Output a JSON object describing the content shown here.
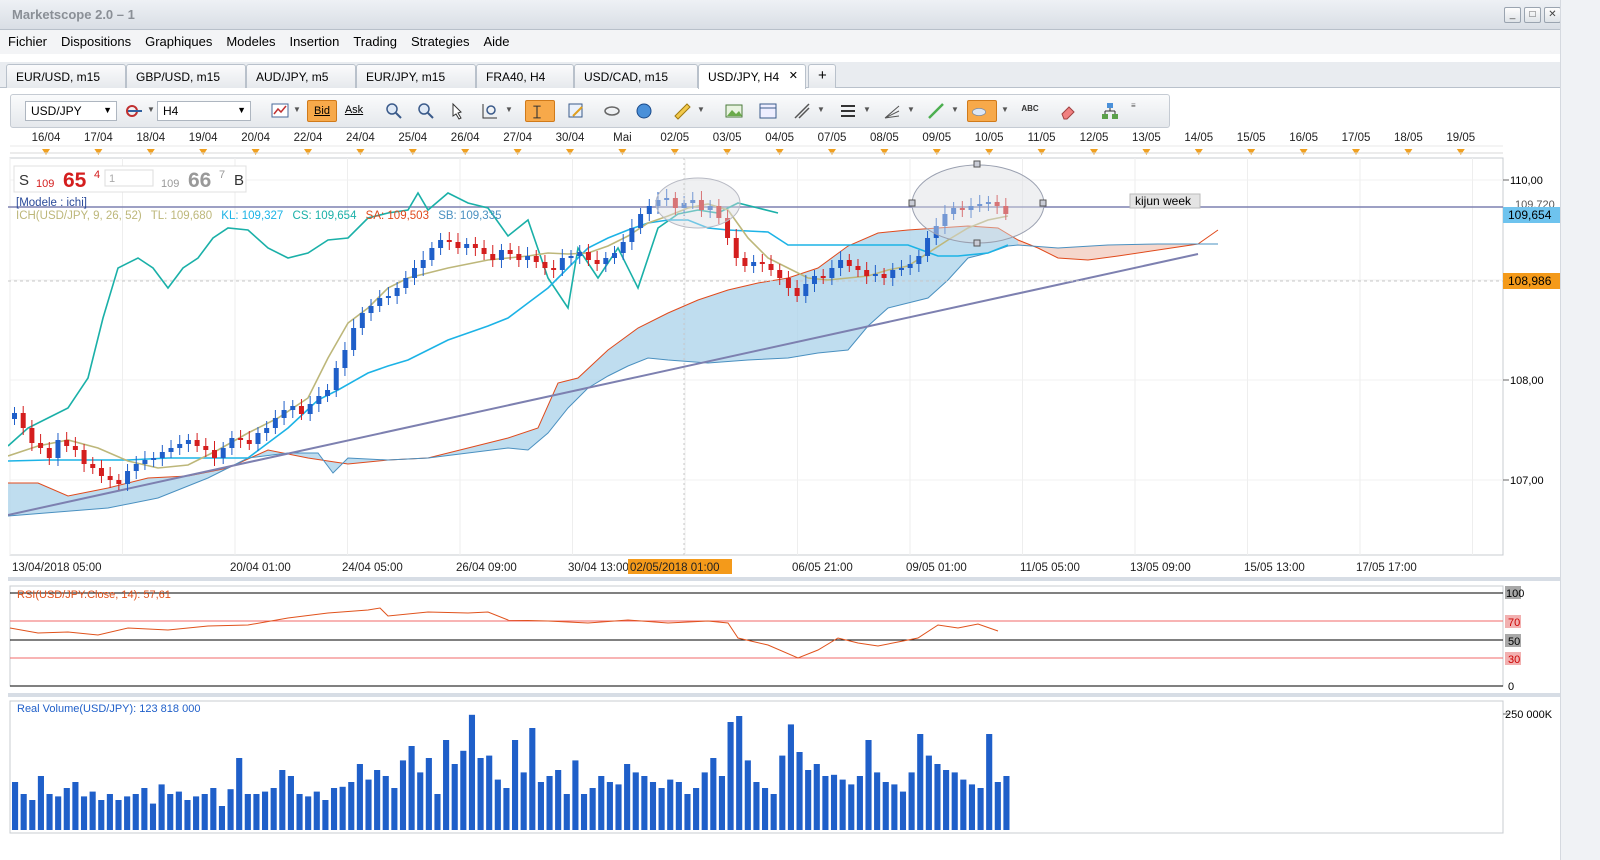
{
  "window": {
    "title": "Marketscope 2.0 – 1"
  },
  "menu": [
    "Fichier",
    "Dispositions",
    "Graphiques",
    "Modeles",
    "Insertion",
    "Trading",
    "Strategies",
    "Aide"
  ],
  "tabs": [
    "EUR/USD, m15",
    "GBP/USD, m15",
    "AUD/JPY, m5",
    "EUR/JPY, m15",
    "FRA40, H4",
    "USD/CAD, m15",
    "USD/JPY, H4"
  ],
  "active_tab": "USD/JPY, H4",
  "toolbar": {
    "symbol": "USD/JPY",
    "timeframe": "H4",
    "bid_label": "Bid",
    "ask_label": "Ask"
  },
  "top_dates": [
    "16/04",
    "17/04",
    "18/04",
    "19/04",
    "20/04",
    "22/04",
    "24/04",
    "25/04",
    "26/04",
    "27/04",
    "30/04",
    "Mai",
    "02/05",
    "03/05",
    "04/05",
    "07/05",
    "08/05",
    "09/05",
    "10/05",
    "11/05",
    "12/05",
    "13/05",
    "14/05",
    "15/05",
    "16/05",
    "17/05",
    "18/05",
    "19/05"
  ],
  "quote": {
    "sell_label": "S",
    "sell_big": "109",
    "sell_main": "65",
    "sell_sup": "4",
    "spread": "1",
    "buy_big": "109",
    "buy_main": "66",
    "buy_sup": "7",
    "buy_label": "B"
  },
  "model_label": "[Modele : ichi]",
  "indicator_label": "ICH(USD/JPY, 9, 26, 52)",
  "indicator_values": {
    "tl": "TL: 109,680",
    "kl": "KL: 109,327",
    "cs": "CS: 109,654",
    "sa": "SA: 109,503",
    "sb": "SB: 109,335"
  },
  "annotation": "kijun week",
  "price_axis": [
    "110,00",
    "108,00",
    "107,00"
  ],
  "price_marker_top": "109,654",
  "price_marker_top_hidden": "109,720",
  "price_marker_bottom": "108,986",
  "bottom_dates": [
    "13/04/2018 05:00",
    "20/04 01:00",
    "24/04 05:00",
    "26/04 09:00",
    "30/04 13:00",
    "02/05/2018 01:00",
    "06/05 21:00",
    "09/05 01:00",
    "11/05 05:00",
    "13/05 09:00",
    "15/05 13:00",
    "17/05 17:00"
  ],
  "rsi": {
    "label": "RSI(USD/JPY.Close, 14): 57,61",
    "levels": [
      "100",
      "70",
      "50",
      "30",
      "0"
    ]
  },
  "volume": {
    "label": "Real Volume(USD/JPY): 123 818 000",
    "axis": "250 000K"
  },
  "colors": {
    "bull": "#1f5fc9",
    "bear": "#d41e1e",
    "tenkan": "#bdb77a",
    "kijun": "#1cb3e6",
    "chikou": "#1ab0a8",
    "cloud": "#a9d2ea",
    "senkou_a": "#e04a1c",
    "trend": "#7d80b0",
    "rsi": "#e0521c",
    "volume": "#1f5fc9"
  }
}
